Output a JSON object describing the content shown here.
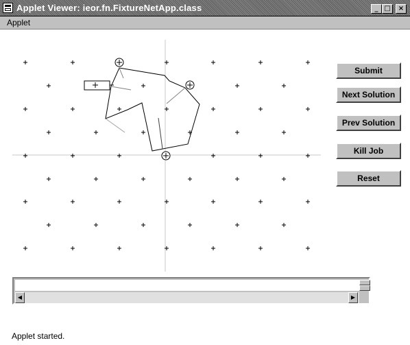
{
  "window": {
    "title": "Applet Viewer: ieor.fn.FixtureNetApp.class",
    "controls": {
      "minimize": "_",
      "maximize": "□",
      "close": "×"
    }
  },
  "menu": {
    "items": [
      "Applet"
    ]
  },
  "buttons": {
    "submit": "Submit",
    "next_solution": "Next Solution",
    "prev_solution": "Prev Solution",
    "kill_job": "Kill Job",
    "reset": "Reset"
  },
  "output": {
    "text": ""
  },
  "scrollbar": {
    "left_arrow": "◀",
    "right_arrow": "▶"
  },
  "status": {
    "text": "Applet started."
  },
  "colors": {
    "chrome": "#c0c0c0",
    "canvas": "#ffffff",
    "axis": "#c8c8c8"
  }
}
